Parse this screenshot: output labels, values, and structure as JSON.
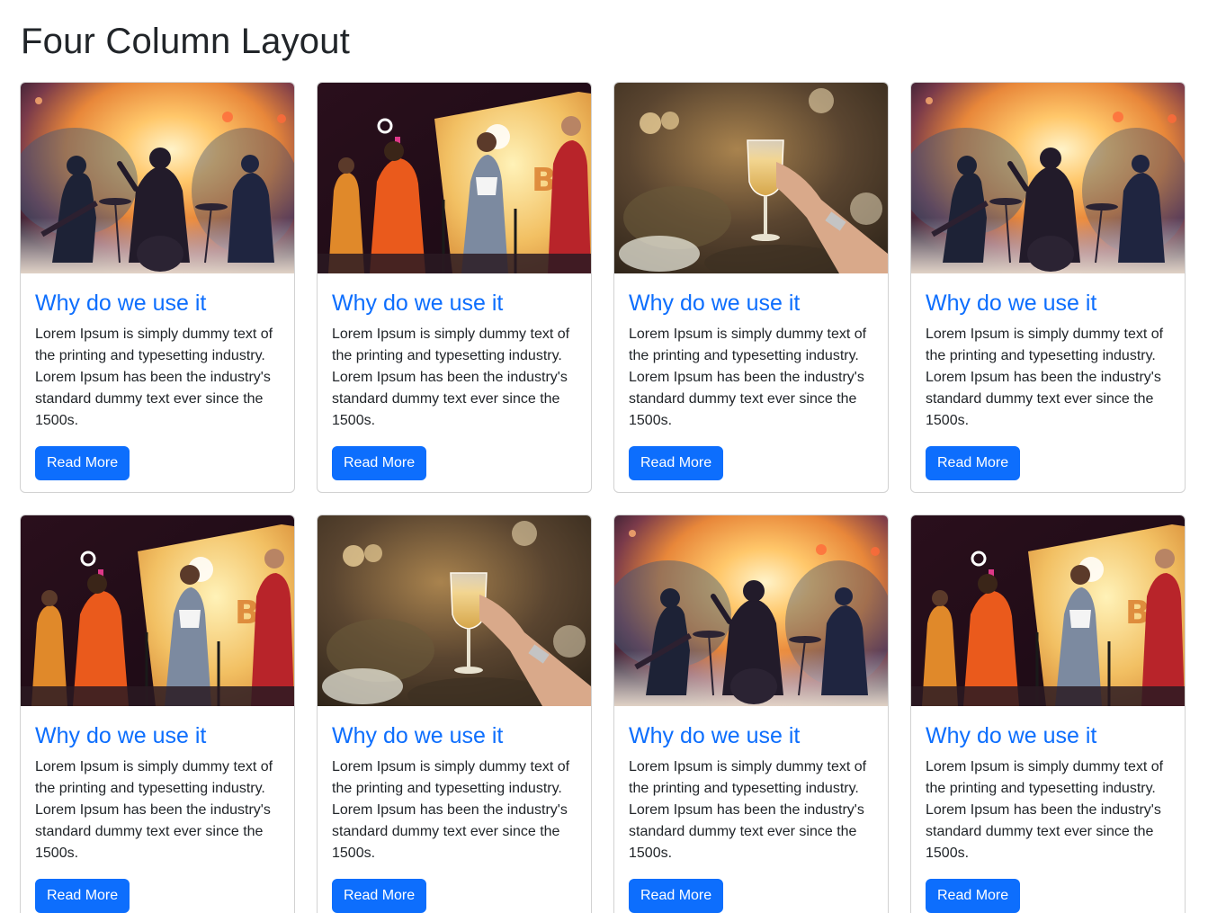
{
  "page": {
    "title": "Four Column Layout"
  },
  "colors": {
    "primary": "#0d6efd",
    "text": "#212529",
    "border": "#dee2e6"
  },
  "cards": [
    {
      "image": "concert-band-watercolor-image",
      "title": "Why do we use it",
      "text": "Lorem Ipsum is simply dummy text of the printing and typesetting industry. Lorem Ipsum has been the industry's standard dummy text ever since the 1500s.",
      "button": "Read More"
    },
    {
      "image": "stage-singers-performance-image",
      "title": "Why do we use it",
      "text": "Lorem Ipsum is simply dummy text of the printing and typesetting industry. Lorem Ipsum has been the industry's standard dummy text ever since the 1500s.",
      "button": "Read More"
    },
    {
      "image": "champagne-glass-toast-image",
      "title": "Why do we use it",
      "text": "Lorem Ipsum is simply dummy text of the printing and typesetting industry. Lorem Ipsum has been the industry's standard dummy text ever since the 1500s.",
      "button": "Read More"
    },
    {
      "image": "concert-band-watercolor-image",
      "title": "Why do we use it",
      "text": "Lorem Ipsum is simply dummy text of the printing and typesetting industry. Lorem Ipsum has been the industry's standard dummy text ever since the 1500s.",
      "button": "Read More"
    },
    {
      "image": "stage-singers-performance-image",
      "title": "Why do we use it",
      "text": "Lorem Ipsum is simply dummy text of the printing and typesetting industry. Lorem Ipsum has been the industry's standard dummy text ever since the 1500s.",
      "button": "Read More"
    },
    {
      "image": "champagne-glass-toast-image",
      "title": "Why do we use it",
      "text": "Lorem Ipsum is simply dummy text of the printing and typesetting industry. Lorem Ipsum has been the industry's standard dummy text ever since the 1500s.",
      "button": "Read More"
    },
    {
      "image": "concert-band-watercolor-image",
      "title": "Why do we use it",
      "text": "Lorem Ipsum is simply dummy text of the printing and typesetting industry. Lorem Ipsum has been the industry's standard dummy text ever since the 1500s.",
      "button": "Read More"
    },
    {
      "image": "stage-singers-performance-image",
      "title": "Why do we use it",
      "text": "Lorem Ipsum is simply dummy text of the printing and typesetting industry. Lorem Ipsum has been the industry's standard dummy text ever since the 1500s.",
      "button": "Read More"
    }
  ]
}
